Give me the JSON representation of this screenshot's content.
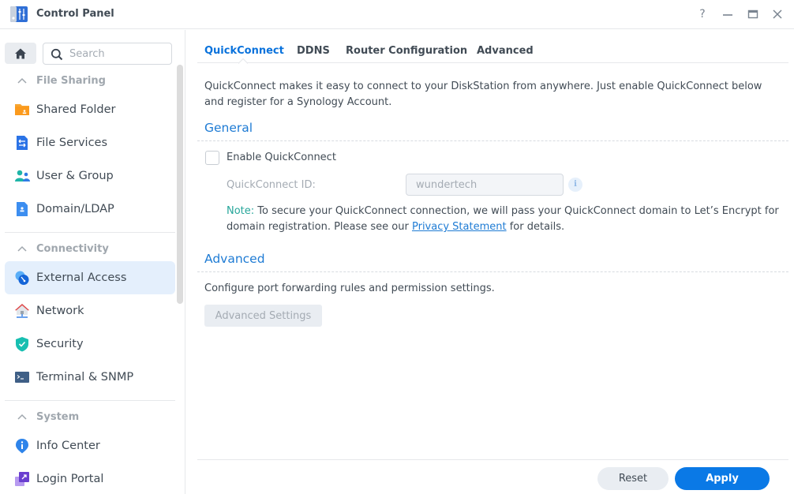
{
  "window": {
    "title": "Control Panel",
    "icon": "control-panel-icon",
    "controls": {
      "help": "?",
      "minimize": "—",
      "maximize": "▭",
      "close": "✕"
    }
  },
  "sidebar": {
    "home_icon": "home-icon",
    "search": {
      "placeholder": "Search",
      "value": ""
    },
    "groups": [
      {
        "label": "File Sharing",
        "expanded": true,
        "items": [
          {
            "label": "Shared Folder",
            "icon": "shared-folder-icon",
            "active": false
          },
          {
            "label": "File Services",
            "icon": "file-services-icon",
            "active": false
          },
          {
            "label": "User & Group",
            "icon": "user-group-icon",
            "active": false
          },
          {
            "label": "Domain/LDAP",
            "icon": "domain-ldap-icon",
            "active": false
          }
        ]
      },
      {
        "label": "Connectivity",
        "expanded": true,
        "items": [
          {
            "label": "External Access",
            "icon": "external-access-icon",
            "active": true
          },
          {
            "label": "Network",
            "icon": "network-icon",
            "active": false
          },
          {
            "label": "Security",
            "icon": "security-shield-icon",
            "active": false
          },
          {
            "label": "Terminal & SNMP",
            "icon": "terminal-icon",
            "active": false
          }
        ]
      },
      {
        "label": "System",
        "expanded": true,
        "items": [
          {
            "label": "Info Center",
            "icon": "info-center-icon",
            "active": false
          },
          {
            "label": "Login Portal",
            "icon": "login-portal-icon",
            "active": false
          }
        ]
      }
    ]
  },
  "main": {
    "tabs": [
      {
        "label": "QuickConnect",
        "active": true
      },
      {
        "label": "DDNS",
        "active": false
      },
      {
        "label": "Router Configuration",
        "active": false
      },
      {
        "label": "Advanced",
        "active": false
      }
    ],
    "intro_line1": "QuickConnect makes it easy to connect to your DiskStation from anywhere. Just enable QuickConnect below",
    "intro_line2": "and register for a Synology Account.",
    "general": {
      "title": "General",
      "enable_label": "Enable QuickConnect",
      "enable_checked": false,
      "id_label": "QuickConnect ID:",
      "id_value": "wundertech",
      "info_icon": "i",
      "note_label": "Note:",
      "note_text": " To secure your QuickConnect connection, we will pass your QuickConnect domain to Let’s Encrypt for domain registration. Please see our ",
      "note_link": "Privacy Statement",
      "note_tail": " for details."
    },
    "advanced": {
      "title": "Advanced",
      "description": "Configure port forwarding rules and permission settings.",
      "button_label": "Advanced Settings"
    },
    "footer": {
      "reset_label": "Reset",
      "apply_label": "Apply"
    }
  },
  "colors": {
    "accent": "#0a79e6",
    "active_tab": "#0972dc",
    "section_title": "#1e7bd4",
    "note_label": "#26a69a",
    "active_nav_bg": "#e4effc"
  }
}
